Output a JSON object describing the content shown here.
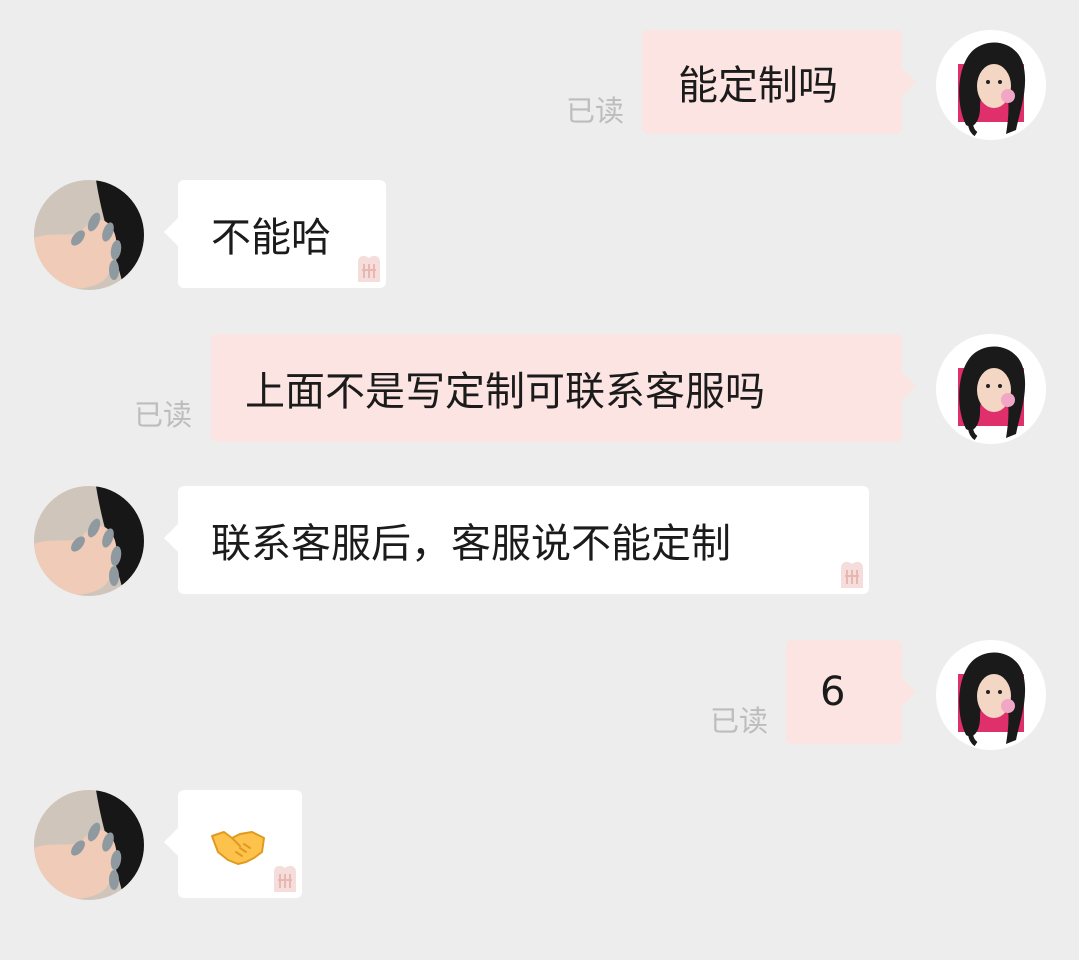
{
  "messages": [
    {
      "sender": "me",
      "text": "能定制吗",
      "status": "已读"
    },
    {
      "sender": "other",
      "text": "不能哈"
    },
    {
      "sender": "me",
      "text": "上面不是写定制可联系客服吗",
      "status": "已读"
    },
    {
      "sender": "other",
      "text": "联系客服后，客服说不能定制"
    },
    {
      "sender": "me",
      "text": "6",
      "status": "已读"
    },
    {
      "sender": "other",
      "icon": "handshake-emoji"
    }
  ],
  "colors": {
    "background": "#ededed",
    "my_bubble": "#fbe4e2",
    "their_bubble": "#ffffff",
    "read_receipt": "#bdbdbd",
    "text": "#1b1b1b"
  },
  "icons": {
    "my_avatar": "girl-portrait-avatar",
    "their_avatar": "manicured-hand-avatar",
    "watermark": "red-logo-watermark-icon"
  }
}
